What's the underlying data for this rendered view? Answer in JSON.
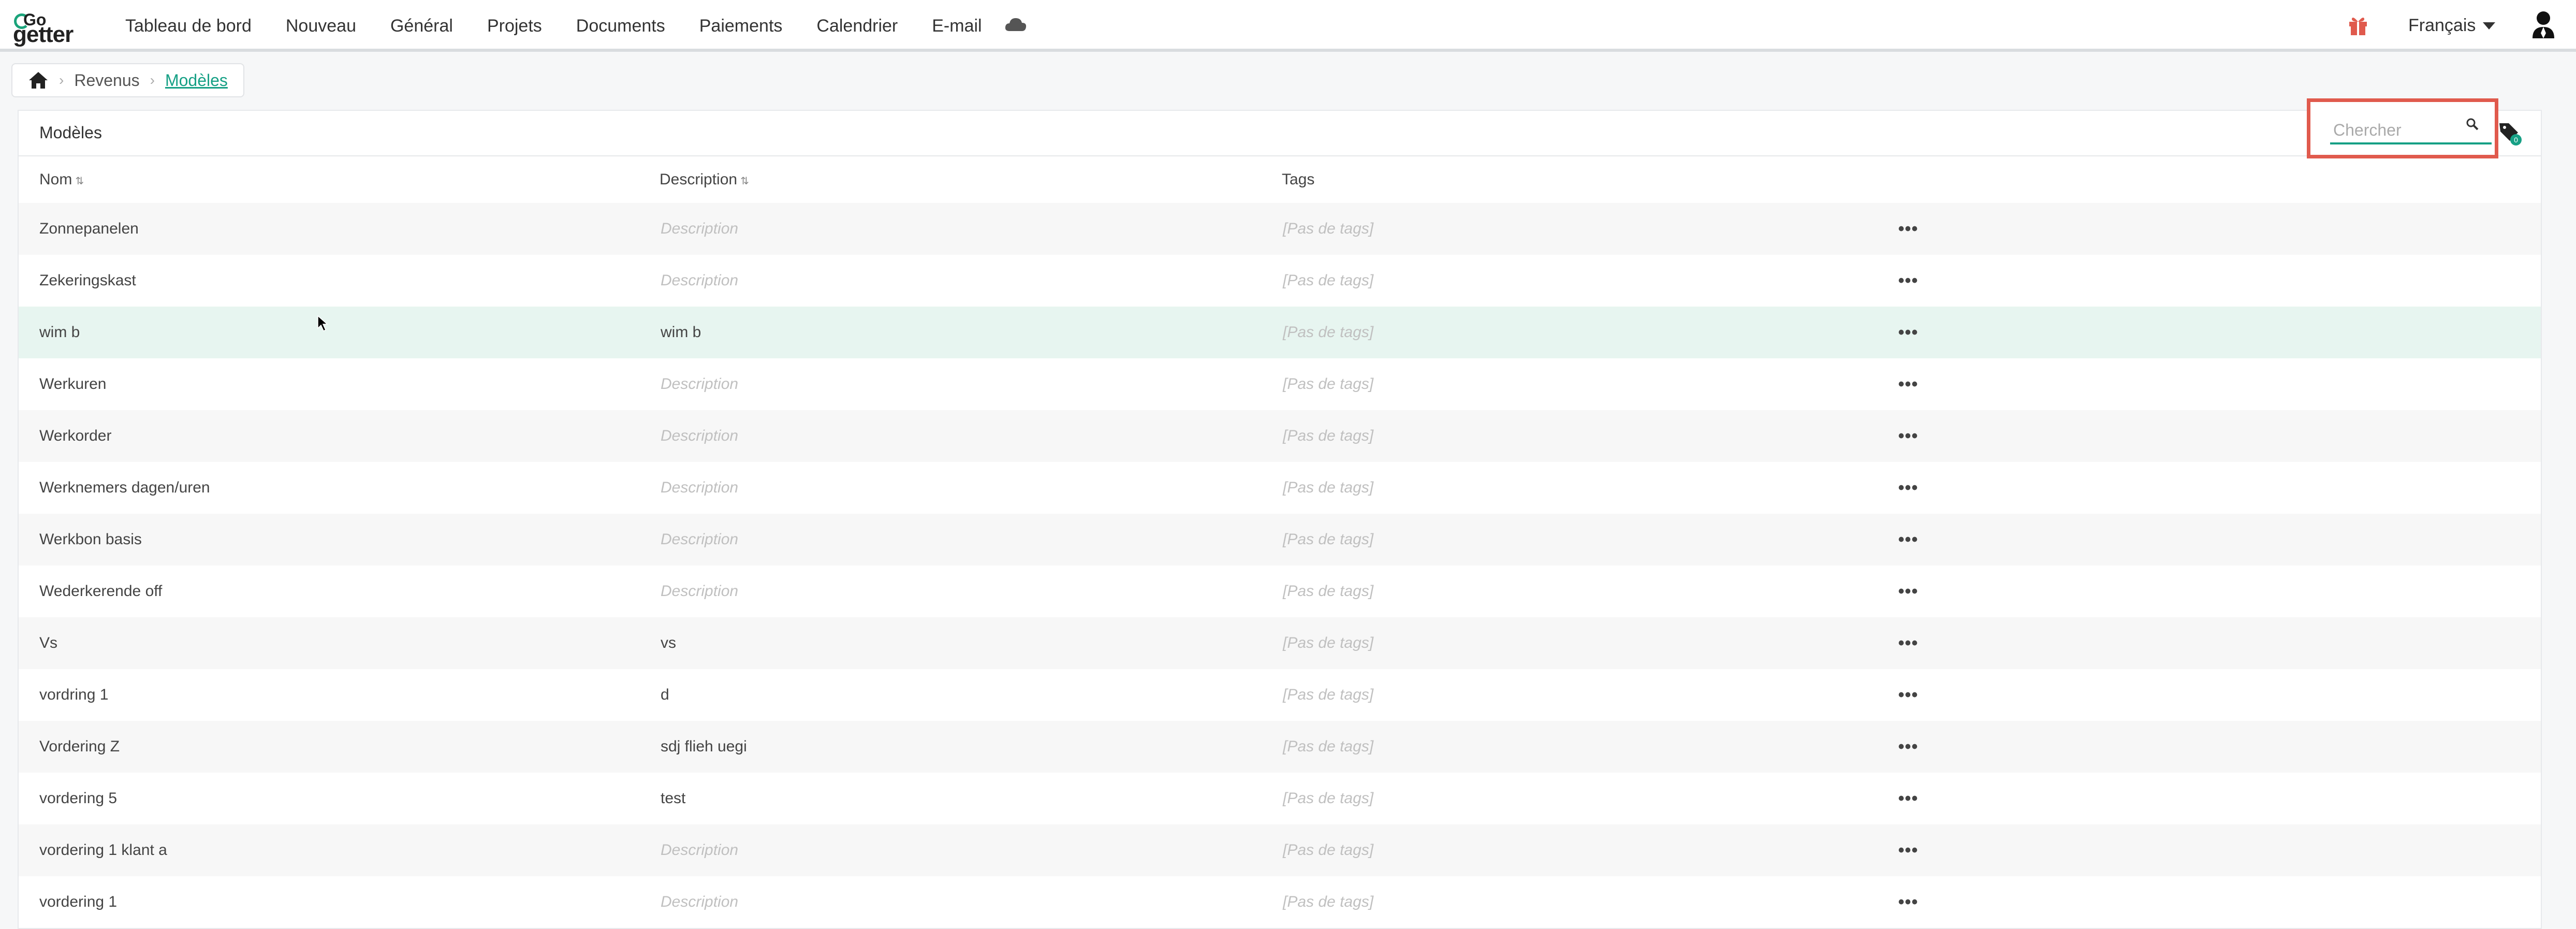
{
  "brand": {
    "line1": "Go",
    "line2": "getter"
  },
  "nav": {
    "items": [
      "Tableau de bord",
      "Nouveau",
      "Général",
      "Projets",
      "Documents",
      "Paiements",
      "Calendrier",
      "E-mail"
    ],
    "language": "Français",
    "icons": [
      "cloud-icon",
      "gift-icon",
      "user-icon"
    ],
    "accent": "#16a085"
  },
  "breadcrumb": {
    "items": [
      "Revenus",
      "Modèles"
    ]
  },
  "panel": {
    "title": "Modèles",
    "search_placeholder": "Chercher",
    "tag_badge": "0"
  },
  "table": {
    "columns": [
      "Nom",
      "Description",
      "Tags"
    ],
    "rows": [
      {
        "name": "Zonnepanelen",
        "description": "Description",
        "description_is_placeholder": true,
        "tags": "[Pas de tags]"
      },
      {
        "name": "Zekeringskast",
        "description": "Description",
        "description_is_placeholder": true,
        "tags": "[Pas de tags]"
      },
      {
        "name": "wim b",
        "description": "wim b",
        "description_is_placeholder": false,
        "tags": "[Pas de tags]",
        "highlighted": true
      },
      {
        "name": "Werkuren",
        "description": "Description",
        "description_is_placeholder": true,
        "tags": "[Pas de tags]"
      },
      {
        "name": "Werkorder",
        "description": "Description",
        "description_is_placeholder": true,
        "tags": "[Pas de tags]"
      },
      {
        "name": "Werknemers dagen/uren",
        "description": "Description",
        "description_is_placeholder": true,
        "tags": "[Pas de tags]"
      },
      {
        "name": "Werkbon basis",
        "description": "Description",
        "description_is_placeholder": true,
        "tags": "[Pas de tags]"
      },
      {
        "name": "Wederkerende off",
        "description": "Description",
        "description_is_placeholder": true,
        "tags": "[Pas de tags]"
      },
      {
        "name": "Vs",
        "description": "vs",
        "description_is_placeholder": false,
        "tags": "[Pas de tags]"
      },
      {
        "name": "vordring 1",
        "description": "d",
        "description_is_placeholder": false,
        "tags": "[Pas de tags]"
      },
      {
        "name": "Vordering Z",
        "description": "sdj flieh uegi",
        "description_is_placeholder": false,
        "tags": "[Pas de tags]"
      },
      {
        "name": "vordering 5",
        "description": "test",
        "description_is_placeholder": false,
        "tags": "[Pas de tags]"
      },
      {
        "name": "vordering 1 klant a",
        "description": "Description",
        "description_is_placeholder": true,
        "tags": "[Pas de tags]"
      },
      {
        "name": "vordering 1",
        "description": "Description",
        "description_is_placeholder": true,
        "tags": "[Pas de tags]"
      }
    ],
    "row_action": "•••"
  }
}
